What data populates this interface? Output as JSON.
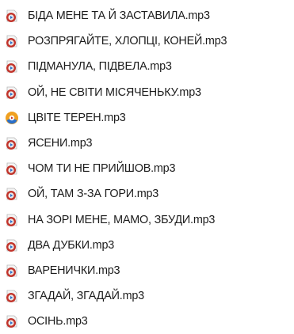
{
  "files": [
    {
      "name": "БІДА МЕНЕ ТА Й ЗАСТАВИЛА.mp3",
      "icon": "media-file-icon"
    },
    {
      "name": "РОЗПРЯГАЙТЕ, ХЛОПЦІ, КОНЕЙ.mp3",
      "icon": "media-file-icon"
    },
    {
      "name": "ПІДМАНУЛА, ПІДВЕЛА.mp3",
      "icon": "media-file-icon"
    },
    {
      "name": "ОЙ, НЕ СВІТИ МІСЯЧЕНЬКУ.mp3",
      "icon": "media-file-icon"
    },
    {
      "name": "ЦВІТЕ ТЕРЕН.mp3",
      "icon": "media-player-icon"
    },
    {
      "name": "ЯСЕНИ.mp3",
      "icon": "media-file-icon"
    },
    {
      "name": "ЧОМ ТИ НЕ ПРИЙШОВ.mp3",
      "icon": "media-file-icon"
    },
    {
      "name": "ОЙ, ТАМ З-ЗА ГОРИ.mp3",
      "icon": "media-file-icon"
    },
    {
      "name": "НА ЗОРІ МЕНЕ, МАМО, ЗБУДИ.mp3",
      "icon": "media-file-icon"
    },
    {
      "name": "ДВА ДУБКИ.mp3",
      "icon": "media-file-icon"
    },
    {
      "name": "ВАРЕНИЧКИ.mp3",
      "icon": "media-file-icon"
    },
    {
      "name": "ЗГАДАЙ, ЗГАДАЙ.mp3",
      "icon": "media-file-icon"
    },
    {
      "name": "ОСІНЬ.mp3",
      "icon": "media-file-icon"
    }
  ],
  "colors": {
    "icon_red": "#c2342b",
    "icon_blue": "#2a6fc9",
    "icon_orange": "#f0a020",
    "text": "#1c1c1c"
  }
}
